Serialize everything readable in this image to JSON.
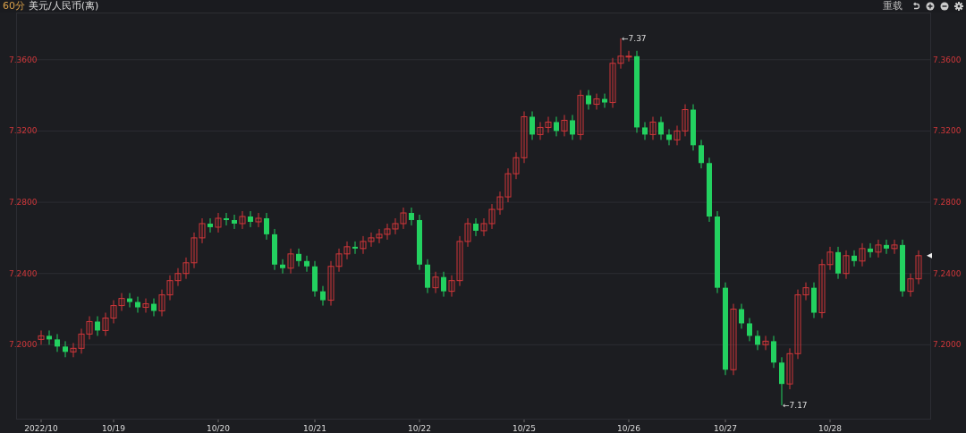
{
  "toolbar": {
    "interval": "60分",
    "symbol": "美元/人民币(离)",
    "reload": "重载"
  },
  "chart": {
    "chart_data": {
      "type": "candlestick",
      "grid": true,
      "ylim": [
        7.1585,
        7.3865
      ],
      "yticks": [
        {
          "value": 7.36,
          "label": "7.3600"
        },
        {
          "value": 7.32,
          "label": "7.3200"
        },
        {
          "value": 7.28,
          "label": "7.2800"
        },
        {
          "value": 7.24,
          "label": "7.2400"
        },
        {
          "value": 7.2,
          "label": "7.2000"
        }
      ],
      "categories": [
        "2022/10",
        null,
        null,
        null,
        null,
        null,
        null,
        null,
        null,
        "10/19",
        null,
        null,
        null,
        null,
        null,
        null,
        null,
        null,
        null,
        null,
        null,
        null,
        "10/20",
        null,
        null,
        null,
        null,
        null,
        null,
        null,
        null,
        null,
        null,
        null,
        "10/21",
        null,
        null,
        null,
        null,
        null,
        null,
        null,
        null,
        null,
        null,
        null,
        null,
        "10/22",
        null,
        null,
        null,
        null,
        null,
        null,
        null,
        null,
        null,
        null,
        null,
        null,
        "10/25",
        null,
        null,
        null,
        null,
        null,
        null,
        null,
        null,
        null,
        null,
        null,
        null,
        "10/26",
        null,
        null,
        null,
        null,
        null,
        null,
        null,
        null,
        null,
        null,
        null,
        "10/27",
        null,
        null,
        null,
        null,
        null,
        null,
        null,
        null,
        null,
        null,
        null,
        null,
        "10/28",
        null,
        null,
        null,
        null,
        null,
        null,
        null,
        null,
        null,
        null,
        null
      ],
      "ohlc": [
        [
          7.203,
          7.208,
          7.2,
          7.205
        ],
        [
          7.205,
          7.208,
          7.2,
          7.203
        ],
        [
          7.203,
          7.206,
          7.196,
          7.199
        ],
        [
          7.199,
          7.202,
          7.193,
          7.196
        ],
        [
          7.196,
          7.201,
          7.193,
          7.198
        ],
        [
          7.198,
          7.209,
          7.195,
          7.206
        ],
        [
          7.206,
          7.216,
          7.203,
          7.213
        ],
        [
          7.213,
          7.216,
          7.205,
          7.208
        ],
        [
          7.208,
          7.218,
          7.205,
          7.215
        ],
        [
          7.215,
          7.225,
          7.212,
          7.222
        ],
        [
          7.222,
          7.229,
          7.219,
          7.226
        ],
        [
          7.226,
          7.229,
          7.221,
          7.224
        ],
        [
          7.224,
          7.227,
          7.218,
          7.221
        ],
        [
          7.221,
          7.226,
          7.218,
          7.223
        ],
        [
          7.223,
          7.226,
          7.216,
          7.219
        ],
        [
          7.219,
          7.231,
          7.216,
          7.228
        ],
        [
          7.228,
          7.239,
          7.225,
          7.236
        ],
        [
          7.236,
          7.243,
          7.233,
          7.24
        ],
        [
          7.24,
          7.249,
          7.237,
          7.246
        ],
        [
          7.246,
          7.263,
          7.243,
          7.26
        ],
        [
          7.26,
          7.271,
          7.257,
          7.268
        ],
        [
          7.268,
          7.271,
          7.263,
          7.266
        ],
        [
          7.266,
          7.274,
          7.263,
          7.271
        ],
        [
          7.271,
          7.274,
          7.267,
          7.27
        ],
        [
          7.27,
          7.273,
          7.265,
          7.268
        ],
        [
          7.268,
          7.275,
          7.265,
          7.272
        ],
        [
          7.272,
          7.275,
          7.266,
          7.269
        ],
        [
          7.269,
          7.274,
          7.266,
          7.271
        ],
        [
          7.271,
          7.274,
          7.259,
          7.262
        ],
        [
          7.262,
          7.265,
          7.242,
          7.245
        ],
        [
          7.245,
          7.248,
          7.24,
          7.243
        ],
        [
          7.243,
          7.254,
          7.24,
          7.251
        ],
        [
          7.251,
          7.254,
          7.244,
          7.247
        ],
        [
          7.247,
          7.25,
          7.241,
          7.244
        ],
        [
          7.244,
          7.247,
          7.227,
          7.23
        ],
        [
          7.23,
          7.233,
          7.222,
          7.225
        ],
        [
          7.225,
          7.247,
          7.222,
          7.244
        ],
        [
          7.244,
          7.254,
          7.241,
          7.251
        ],
        [
          7.251,
          7.258,
          7.248,
          7.255
        ],
        [
          7.255,
          7.258,
          7.251,
          7.254
        ],
        [
          7.254,
          7.261,
          7.251,
          7.258
        ],
        [
          7.258,
          7.263,
          7.255,
          7.26
        ],
        [
          7.26,
          7.265,
          7.257,
          7.262
        ],
        [
          7.262,
          7.268,
          7.259,
          7.265
        ],
        [
          7.265,
          7.271,
          7.262,
          7.268
        ],
        [
          7.268,
          7.277,
          7.265,
          7.274
        ],
        [
          7.274,
          7.277,
          7.267,
          7.27
        ],
        [
          7.27,
          7.273,
          7.242,
          7.245
        ],
        [
          7.245,
          7.248,
          7.229,
          7.232
        ],
        [
          7.232,
          7.241,
          7.229,
          7.238
        ],
        [
          7.238,
          7.241,
          7.227,
          7.23
        ],
        [
          7.23,
          7.239,
          7.227,
          7.236
        ],
        [
          7.236,
          7.261,
          7.233,
          7.258
        ],
        [
          7.258,
          7.271,
          7.255,
          7.268
        ],
        [
          7.268,
          7.271,
          7.261,
          7.264
        ],
        [
          7.264,
          7.271,
          7.261,
          7.268
        ],
        [
          7.268,
          7.279,
          7.265,
          7.276
        ],
        [
          7.276,
          7.286,
          7.273,
          7.283
        ],
        [
          7.283,
          7.299,
          7.28,
          7.296
        ],
        [
          7.296,
          7.308,
          7.293,
          7.305
        ],
        [
          7.305,
          7.331,
          7.302,
          7.328
        ],
        [
          7.328,
          7.331,
          7.315,
          7.318
        ],
        [
          7.318,
          7.325,
          7.315,
          7.322
        ],
        [
          7.322,
          7.328,
          7.319,
          7.325
        ],
        [
          7.325,
          7.328,
          7.317,
          7.32
        ],
        [
          7.32,
          7.329,
          7.317,
          7.326
        ],
        [
          7.326,
          7.329,
          7.315,
          7.318
        ],
        [
          7.318,
          7.343,
          7.315,
          7.34
        ],
        [
          7.34,
          7.343,
          7.332,
          7.335
        ],
        [
          7.335,
          7.341,
          7.332,
          7.338
        ],
        [
          7.338,
          7.341,
          7.333,
          7.336
        ],
        [
          7.336,
          7.361,
          7.333,
          7.358
        ],
        [
          7.358,
          7.372,
          7.355,
          7.362
        ],
        [
          7.362,
          7.365,
          7.359,
          7.362
        ],
        [
          7.362,
          7.365,
          7.319,
          7.322
        ],
        [
          7.322,
          7.325,
          7.315,
          7.318
        ],
        [
          7.318,
          7.328,
          7.315,
          7.325
        ],
        [
          7.325,
          7.328,
          7.315,
          7.318
        ],
        [
          7.318,
          7.321,
          7.312,
          7.315
        ],
        [
          7.315,
          7.323,
          7.312,
          7.32
        ],
        [
          7.32,
          7.335,
          7.317,
          7.332
        ],
        [
          7.332,
          7.335,
          7.309,
          7.312
        ],
        [
          7.312,
          7.315,
          7.299,
          7.302
        ],
        [
          7.302,
          7.305,
          7.269,
          7.272
        ],
        [
          7.272,
          7.275,
          7.229,
          7.232
        ],
        [
          7.232,
          7.235,
          7.183,
          7.186
        ],
        [
          7.186,
          7.223,
          7.183,
          7.22
        ],
        [
          7.22,
          7.223,
          7.209,
          7.212
        ],
        [
          7.212,
          7.215,
          7.202,
          7.205
        ],
        [
          7.205,
          7.208,
          7.197,
          7.2
        ],
        [
          7.2,
          7.205,
          7.197,
          7.202
        ],
        [
          7.202,
          7.205,
          7.187,
          7.19
        ],
        [
          7.19,
          7.193,
          7.166,
          7.178
        ],
        [
          7.178,
          7.198,
          7.175,
          7.195
        ],
        [
          7.195,
          7.231,
          7.192,
          7.228
        ],
        [
          7.228,
          7.235,
          7.225,
          7.232
        ],
        [
          7.232,
          7.235,
          7.215,
          7.218
        ],
        [
          7.218,
          7.248,
          7.215,
          7.245
        ],
        [
          7.245,
          7.255,
          7.242,
          7.252
        ],
        [
          7.252,
          7.255,
          7.237,
          7.24
        ],
        [
          7.24,
          7.253,
          7.237,
          7.25
        ],
        [
          7.25,
          7.253,
          7.244,
          7.247
        ],
        [
          7.247,
          7.257,
          7.244,
          7.254
        ],
        [
          7.254,
          7.257,
          7.249,
          7.252
        ],
        [
          7.252,
          7.259,
          7.249,
          7.256
        ],
        [
          7.256,
          7.259,
          7.251,
          7.254
        ],
        [
          7.254,
          7.259,
          7.251,
          7.256
        ],
        [
          7.256,
          7.259,
          7.227,
          7.23
        ],
        [
          7.23,
          7.24,
          7.227,
          7.237
        ],
        [
          7.237,
          7.253,
          7.234,
          7.25
        ]
      ],
      "annotations": [
        "←7.37",
        "←7.17"
      ]
    }
  }
}
